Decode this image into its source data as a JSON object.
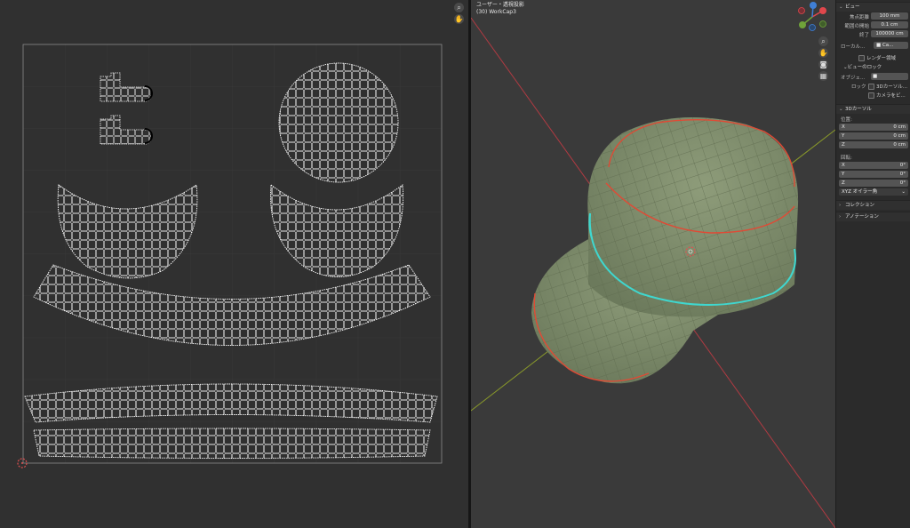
{
  "uv_editor": {
    "cursor_icon": "2d-cursor-icon",
    "tools": [
      {
        "name": "zoom-icon",
        "glyph": "⌕"
      },
      {
        "name": "hand-pan-icon",
        "glyph": "✋"
      }
    ]
  },
  "viewport": {
    "header_line1": "ユーザー・透視投影",
    "header_line2": "(30) WorkCap3",
    "nav_tools": [
      {
        "name": "zoom-icon",
        "glyph": "⌕"
      },
      {
        "name": "hand-pan-icon",
        "glyph": "✋"
      },
      {
        "name": "camera-icon",
        "glyph": "◙"
      },
      {
        "name": "grid-view-icon",
        "glyph": "▦"
      }
    ],
    "gizmo": {
      "x_color": "#e0474c",
      "y_color": "#6fa33a",
      "z_color": "#3f7fd6"
    }
  },
  "npanel": {
    "view_section": "ビュー",
    "focal_label": "焦点距離",
    "focal_value": "100 mm",
    "clip_start_label": "範囲の開始",
    "clip_start_value": "0.1 cm",
    "clip_end_label": "終了",
    "clip_end_value": "100000 cm",
    "local_label": "ローカル...",
    "local_value": "Ca...",
    "render_region_label": "レンダー領域",
    "view_lock_section": "ビューのロック",
    "object_label": "オブジェ...",
    "lock_label": "ロック",
    "lock_cursor_label": "3Dカーソル...",
    "lock_camera_label": "カメラをビ...",
    "cursor_section": "3Dカーソル",
    "location_label": "位置:",
    "location": [
      {
        "axis": "X",
        "value": "0 cm"
      },
      {
        "axis": "Y",
        "value": "0 cm"
      },
      {
        "axis": "Z",
        "value": "0 cm"
      }
    ],
    "rotation_label": "回転:",
    "rotation": [
      {
        "axis": "X",
        "value": "0°"
      },
      {
        "axis": "Y",
        "value": "0°"
      },
      {
        "axis": "Z",
        "value": "0°"
      }
    ],
    "rotation_mode": "XYZ オイラー角",
    "collection_section": "コレクション",
    "annotation_section": "アノテーション"
  },
  "colors": {
    "seam": "#e04a35",
    "selected_edge": "#3fd7cf",
    "mesh_face": "#7c8a68",
    "x_axis_line": "#b03a42",
    "y_axis_line": "#8a9a2a"
  }
}
